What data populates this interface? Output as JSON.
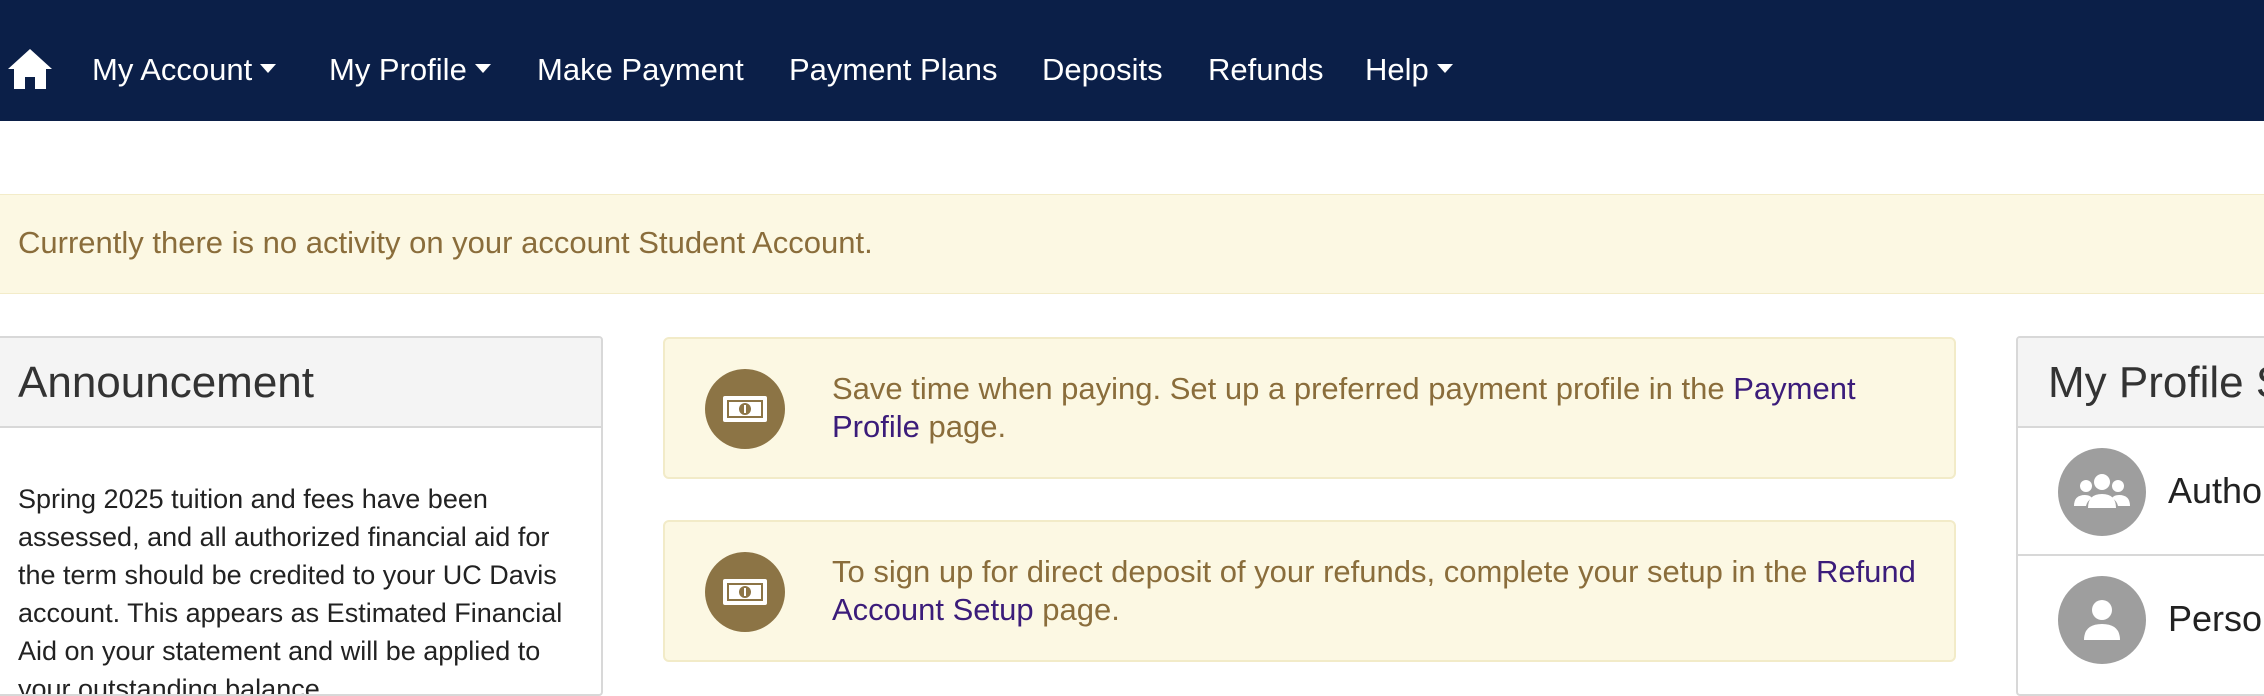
{
  "nav": {
    "home_icon": "home-icon",
    "items": [
      {
        "label": "My Account",
        "dropdown": true
      },
      {
        "label": "My Profile",
        "dropdown": true
      },
      {
        "label": "Make Payment",
        "dropdown": false
      },
      {
        "label": "Payment Plans",
        "dropdown": false
      },
      {
        "label": "Deposits",
        "dropdown": false
      },
      {
        "label": "Refunds",
        "dropdown": false
      },
      {
        "label": "Help",
        "dropdown": true
      }
    ]
  },
  "alert": {
    "text": "Currently there is no activity on your account Student Account."
  },
  "announcement": {
    "title": "Announcement",
    "body": "Spring 2025 tuition and fees have been assessed, and all authorized financial aid for the term should be credited to your UC Davis account. This appears as Estimated Financial Aid on your statement and will be applied to your outstanding balance"
  },
  "cards": [
    {
      "icon": "money-icon",
      "text_before": "Save time when paying. Set up a preferred payment profile in the ",
      "link": "Payment Profile",
      "text_after": " page."
    },
    {
      "icon": "money-icon",
      "text_before": "To sign up for direct deposit of your refunds, complete your setup in the ",
      "link": "Refund Account Setup",
      "text_after": " page."
    }
  ],
  "profile_panel": {
    "title": "My Profile S",
    "rows": [
      {
        "icon": "users-group-icon",
        "label": "Author"
      },
      {
        "icon": "user-icon",
        "label": "Person"
      }
    ]
  },
  "colors": {
    "navbar": "#0b1f48",
    "alert_bg": "#fcf8e3",
    "alert_text": "#8a6d3b",
    "link": "#3b1c7a",
    "badge": "#8c7445"
  }
}
